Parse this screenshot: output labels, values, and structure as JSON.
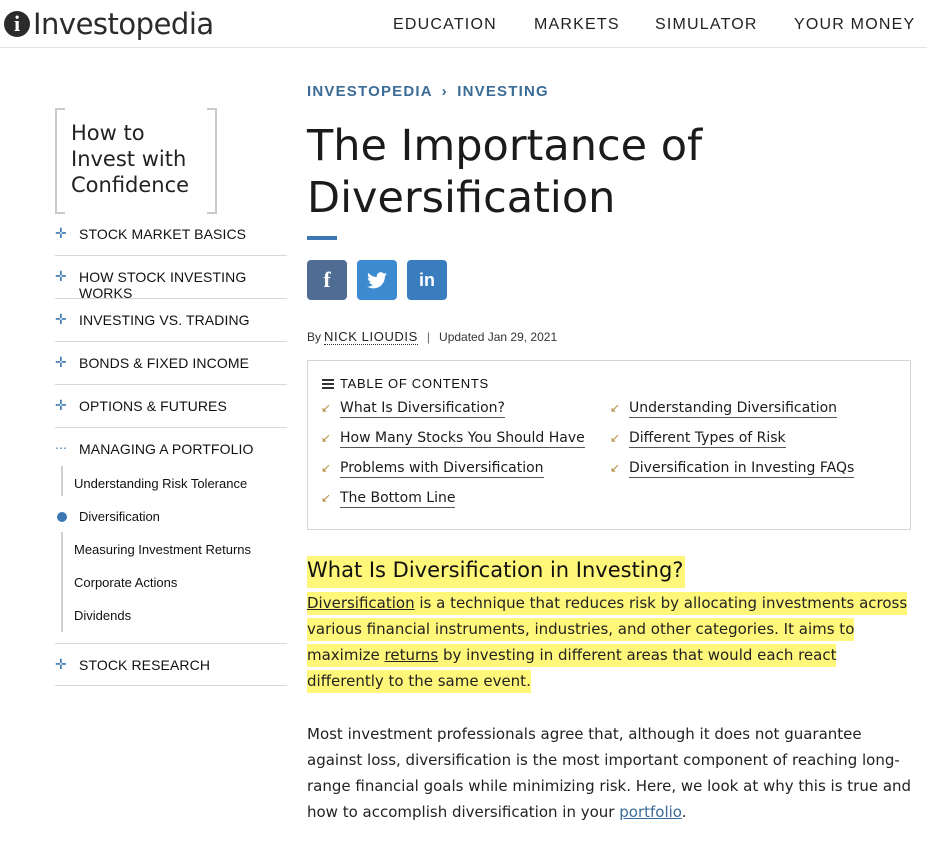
{
  "header": {
    "logo_mark": "i",
    "logo_text": "Investopedia",
    "nav": [
      "EDUCATION",
      "MARKETS",
      "SIMULATOR",
      "YOUR MONEY"
    ]
  },
  "sidebar": {
    "title": "How to Invest with Confidence",
    "items": [
      {
        "label": "STOCK MARKET BASICS",
        "icon": "plus-icon"
      },
      {
        "label": "HOW STOCK INVESTING WORKS",
        "icon": "plus-icon"
      },
      {
        "label": "INVESTING VS. TRADING",
        "icon": "plus-icon"
      },
      {
        "label": "BONDS & FIXED INCOME",
        "icon": "plus-icon"
      },
      {
        "label": "OPTIONS & FUTURES",
        "icon": "plus-icon"
      },
      {
        "label": "MANAGING A PORTFOLIO",
        "icon": "minus-icon"
      },
      {
        "label": "STOCK RESEARCH",
        "icon": "plus-icon"
      }
    ],
    "subitems": [
      "Understanding Risk Tolerance",
      "Diversification",
      "Measuring Investment Returns",
      "Corporate Actions",
      "Dividends"
    ]
  },
  "article": {
    "breadcrumb": {
      "home": "INVESTOPEDIA",
      "sep": "›",
      "section": "INVESTING"
    },
    "title": "The Importance of Diversification",
    "share": {
      "facebook": "f",
      "twitter": "🐦",
      "linkedin": "in"
    },
    "byline": {
      "by": "By",
      "author": "NICK LIOUDIS",
      "sep": "|",
      "updated": "Updated Jan 29, 2021"
    },
    "toc": {
      "heading": "TABLE OF CONTENTS",
      "left": [
        "What Is Diversification?",
        "How Many Stocks You Should Have",
        "Problems with Diversification",
        "The Bottom Line"
      ],
      "right": [
        "Understanding Diversification",
        "Different Types of Risk",
        "Diversification in Investing FAQs"
      ]
    },
    "section_heading": "What Is Diversification in Investing?",
    "p1": {
      "link1": "Diversification",
      "text1": " is a technique that reduces risk by allocating investments across various financial instruments, industries, and other categories. It aims to maximize ",
      "link2": "returns",
      "text2": " by investing in different areas that would each react differently to the same event."
    },
    "p2": {
      "text": "Most investment professionals agree that, although it does not guarantee against loss, diversification is the most important component of reaching long-range financial goals while minimizing risk. Here, we look at why this is true and how to accomplish diversification in your ",
      "link": "portfolio",
      "end": "."
    }
  },
  "colors": {
    "accent": "#3b78b3",
    "highlight": "#fff77a",
    "breadcrumb": "#3b6c97"
  }
}
